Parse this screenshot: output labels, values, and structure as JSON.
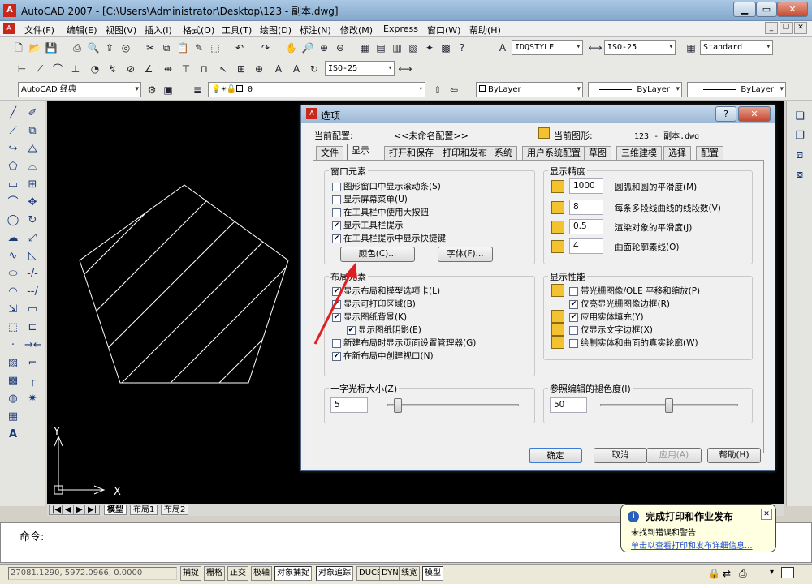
{
  "window": {
    "title": "AutoCAD 2007 - [C:\\Users\\Administrator\\Desktop\\123 - 副本.dwg]",
    "app_icon": "A"
  },
  "menu": {
    "items": [
      "文件(F)",
      "编辑(E)",
      "视图(V)",
      "插入(I)",
      "格式(O)",
      "工具(T)",
      "绘图(D)",
      "标注(N)",
      "修改(M)",
      "Express",
      "窗口(W)",
      "帮助(H)"
    ]
  },
  "styles": {
    "text_style": "IDQSTYLE",
    "dim_style": "ISO-25",
    "table_style": "Standard",
    "dim_style2": "ISO-25"
  },
  "workspace": {
    "name": "AutoCAD 经典"
  },
  "layers": {
    "current": "0"
  },
  "properties": {
    "color": "ByLayer",
    "linetype": "ByLayer",
    "lineweight": "ByLayer"
  },
  "ucs": {
    "x_label": "X",
    "y_label": "Y"
  },
  "layout_tabs": [
    "模型",
    "布局1",
    "布局2"
  ],
  "command": {
    "prompt": "命令:"
  },
  "status": {
    "coords": "27081.1290, 5972.0966, 0.0000",
    "toggles": [
      "捕捉",
      "栅格",
      "正交",
      "极轴",
      "对象捕捉",
      "对象追踪",
      "DUCS",
      "DYN",
      "线宽",
      "模型"
    ]
  },
  "dialog": {
    "title": "选项",
    "help": "?",
    "close": "✕",
    "profile_label": "当前配置:",
    "profile_value": "<<未命名配置>>",
    "drawing_label": "当前图形:",
    "drawing_value": "123 - 副本.dwg",
    "tabs": [
      "文件",
      "显示",
      "打开和保存",
      "打印和发布",
      "系统",
      "用户系统配置",
      "草图",
      "三维建模",
      "选择",
      "配置"
    ],
    "window_elements": {
      "title": "窗口元素",
      "options": [
        {
          "label": "图形窗口中显示滚动条(S)",
          "checked": false
        },
        {
          "label": "显示屏幕菜单(U)",
          "checked": false
        },
        {
          "label": "在工具栏中使用大按钮",
          "checked": false
        },
        {
          "label": "显示工具栏提示",
          "checked": true
        },
        {
          "label": "在工具栏提示中显示快捷键",
          "checked": true
        }
      ],
      "color_button": "颜色(C)...",
      "font_button": "字体(F)..."
    },
    "layout_elements": {
      "title": "布局元素",
      "options": [
        {
          "label": "显示布局和模型选项卡(L)",
          "checked": true
        },
        {
          "label": "显示可打印区域(B)",
          "checked": true
        },
        {
          "label": "显示图纸背景(K)",
          "checked": true
        },
        {
          "label": "显示图纸阴影(E)",
          "checked": true
        },
        {
          "label": "新建布局时显示页面设置管理器(G)",
          "checked": false
        },
        {
          "label": "在新布局中创建视口(N)",
          "checked": true
        }
      ]
    },
    "crosshair": {
      "title": "十字光标大小(Z)",
      "value": "5",
      "level": 0.05
    },
    "resolution": {
      "title": "显示精度",
      "items": [
        {
          "value": "1000",
          "label": "圆弧和圆的平滑度(M)"
        },
        {
          "value": "8",
          "label": "每条多段线曲线的线段数(V)"
        },
        {
          "value": "0.5",
          "label": "渲染对象的平滑度(J)"
        },
        {
          "value": "4",
          "label": "曲面轮廓素线(O)"
        }
      ]
    },
    "performance": {
      "title": "显示性能",
      "options": [
        {
          "label": "带光栅图像/OLE 平移和缩放(P)",
          "checked": false
        },
        {
          "label": "仅亮显光栅图像边框(R)",
          "checked": true
        },
        {
          "label": "应用实体填充(Y)",
          "checked": true
        },
        {
          "label": "仅显示文字边框(X)",
          "checked": false
        },
        {
          "label": "绘制实体和曲面的真实轮廓(W)",
          "checked": false
        }
      ]
    },
    "xref_fade": {
      "title": "参照编辑的褪色度(I)",
      "value": "50",
      "level": 0.5
    },
    "buttons": {
      "ok": "确定",
      "cancel": "取消",
      "apply": "应用(A)",
      "help": "帮助(H)"
    }
  },
  "notification": {
    "title": "完成打印和作业发布",
    "line1": "未找到错误和警告",
    "link": "单击以查看打印和发布详细信息...",
    "close": "✕"
  },
  "colors": {
    "annotation_arrow": "#e02020",
    "canvas": "#000000",
    "drawing_lines": "#ffffff"
  }
}
